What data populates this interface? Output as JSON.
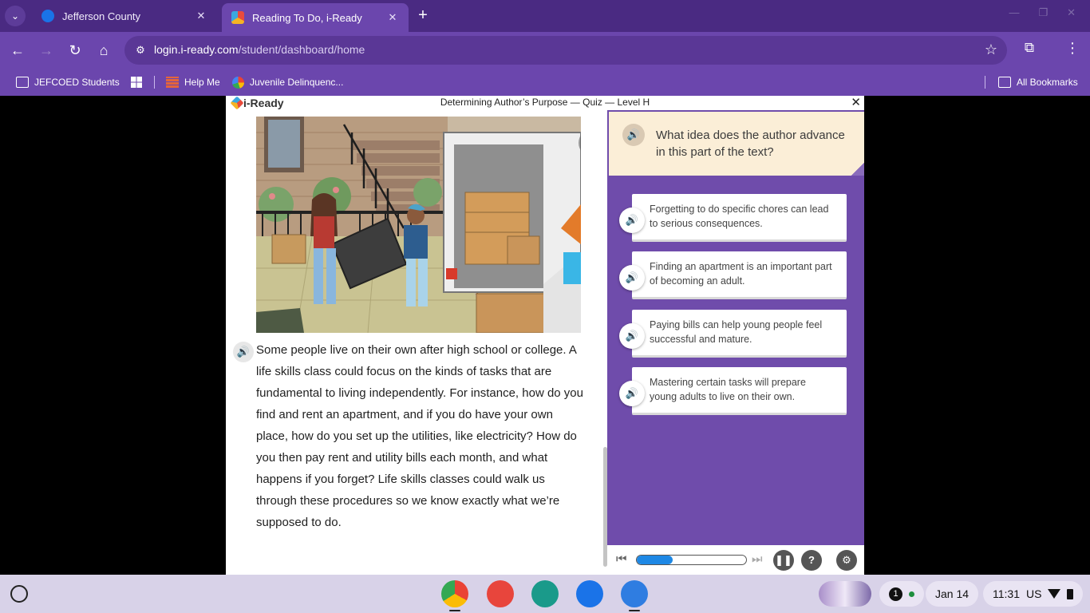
{
  "browser": {
    "tabs": [
      {
        "title": "Jefferson County",
        "active": false
      },
      {
        "title": "Reading To Do, i-Ready",
        "active": true
      }
    ],
    "url_host": "login.i-ready.com",
    "url_path": "/student/dashboard/home",
    "bookmarks": [
      {
        "label": "JEFCOED Students",
        "icon": "folder-icon"
      },
      {
        "label": "",
        "icon": "apps-grid-icon"
      },
      {
        "label": "Help Me",
        "icon": "brick-icon"
      },
      {
        "label": "Juvenile Delinquenc...",
        "icon": "google-icon"
      },
      {
        "label": "All Bookmarks",
        "icon": "folder-icon"
      }
    ]
  },
  "lesson": {
    "logo": "i-Ready",
    "title": "Determining Author’s Purpose — Quiz — Level H",
    "passage": "Some people live on their own after high school or college. A life skills class could focus on the kinds of tasks that are fundamental to living independently. For instance, how do you find and rent an apartment, and if you do have your own place, how do you set up the utilities, like electricity? How do you then pay rent and utility bills each month, and what happens if you forget? Life skills classes could walk us through these procedures so we know exactly what we’re supposed to do.",
    "question": "What idea does the author advance in this part of the text?",
    "answers": [
      "Forgetting to do specific chores can lead to serious consequences.",
      "Finding an apartment is an important part of becoming an adult.",
      "Paying bills can help young people feel successful and mature.",
      "Mastering certain tasks will prepare young adults to live on their own."
    ],
    "progress_fraction": 0.33
  },
  "shelf": {
    "notification_count": "1",
    "date": "Jan 14",
    "time": "11:31",
    "locale": "US"
  },
  "colors": {
    "chrome_purple": "#6b46ad",
    "question_pane": "#6f4cab",
    "progress_blue": "#1e88e5"
  }
}
